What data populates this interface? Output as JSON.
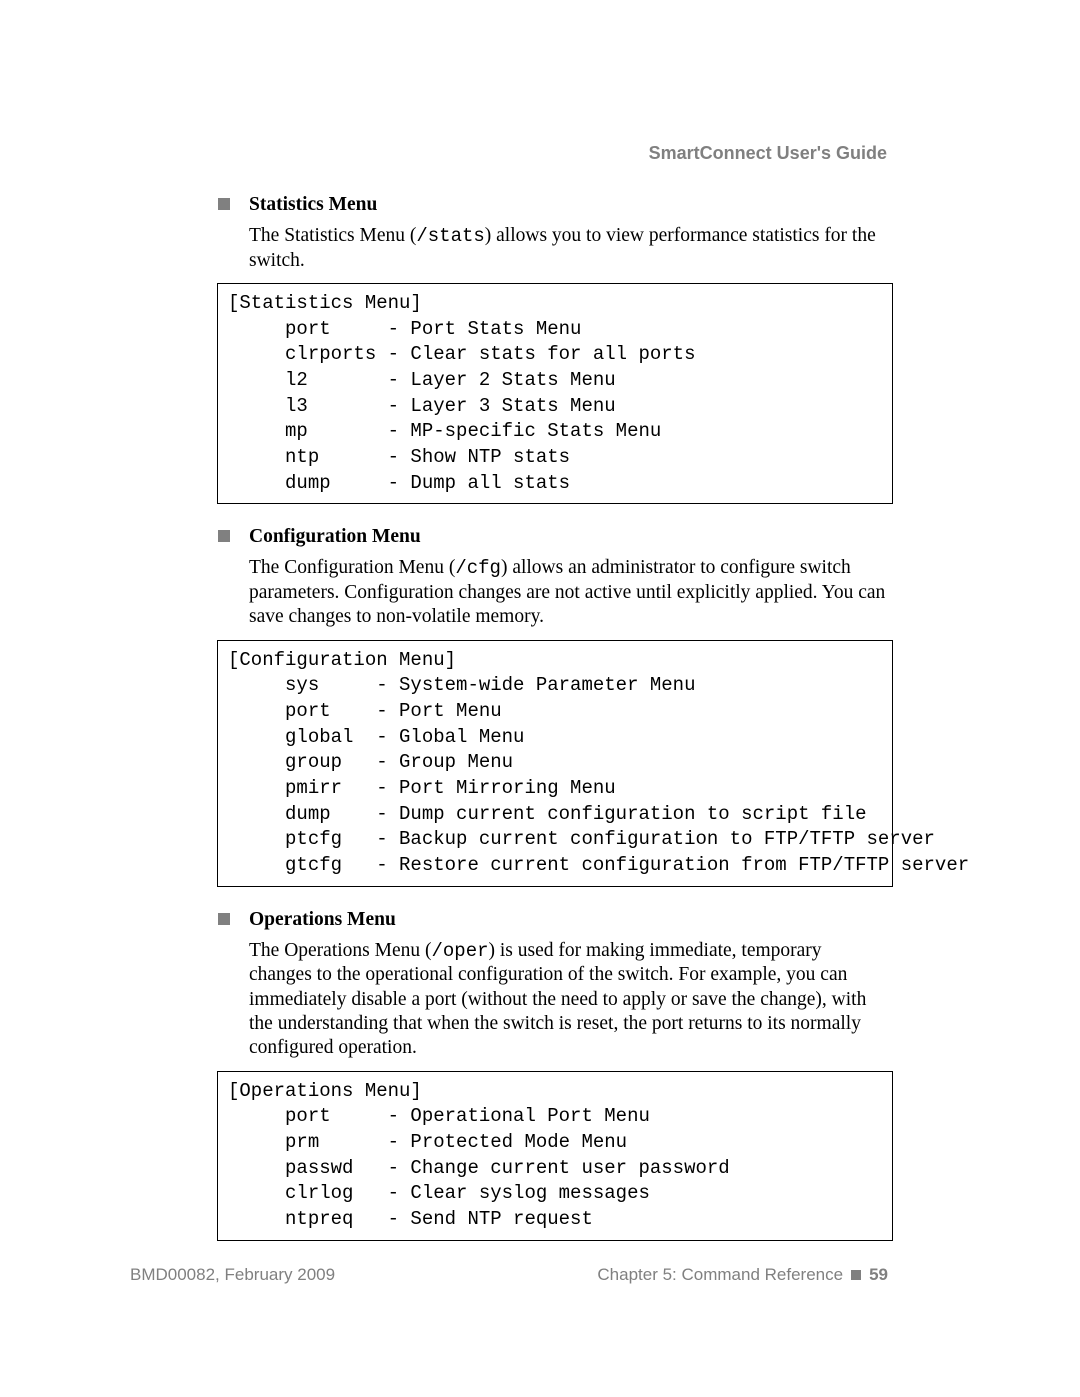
{
  "header": {
    "title": "SmartConnect User's Guide"
  },
  "sections": [
    {
      "heading": "Statistics Menu",
      "para_parts": [
        "The Statistics Menu (",
        "/stats",
        ") allows you to view performance statistics for the switch."
      ],
      "code": "[Statistics Menu]\n     port     - Port Stats Menu\n     clrports - Clear stats for all ports\n     l2       - Layer 2 Stats Menu\n     l3       - Layer 3 Stats Menu\n     mp       - MP-specific Stats Menu\n     ntp      - Show NTP stats\n     dump     - Dump all stats"
    },
    {
      "heading": "Configuration Menu",
      "para_parts": [
        "The Configuration Menu (",
        "/cfg",
        ") allows an administrator to configure switch parameters. Configuration changes are not active until explicitly applied. You can save changes to non-volatile memory."
      ],
      "code": "[Configuration Menu]\n     sys     - System-wide Parameter Menu\n     port    - Port Menu\n     global  - Global Menu\n     group   - Group Menu\n     pmirr   - Port Mirroring Menu\n     dump    - Dump current configuration to script file\n     ptcfg   - Backup current configuration to FTP/TFTP server\n     gtcfg   - Restore current configuration from FTP/TFTP server"
    },
    {
      "heading": "Operations Menu",
      "para_parts": [
        "The Operations Menu (",
        "/oper",
        ") is used for making immediate, temporary changes to the operational configuration of the switch. For example, you can immediately disable a port (without the need to apply or save the change), with the understanding that when the switch is reset, the port returns to its normally configured operation."
      ],
      "code": "[Operations Menu]\n     port     - Operational Port Menu\n     prm      - Protected Mode Menu\n     passwd   - Change current user password\n     clrlog   - Clear syslog messages\n     ntpreq   - Send NTP request"
    }
  ],
  "footer": {
    "left": "BMD00082, February 2009",
    "chapter": "Chapter 5: Command Reference",
    "page": "59"
  }
}
